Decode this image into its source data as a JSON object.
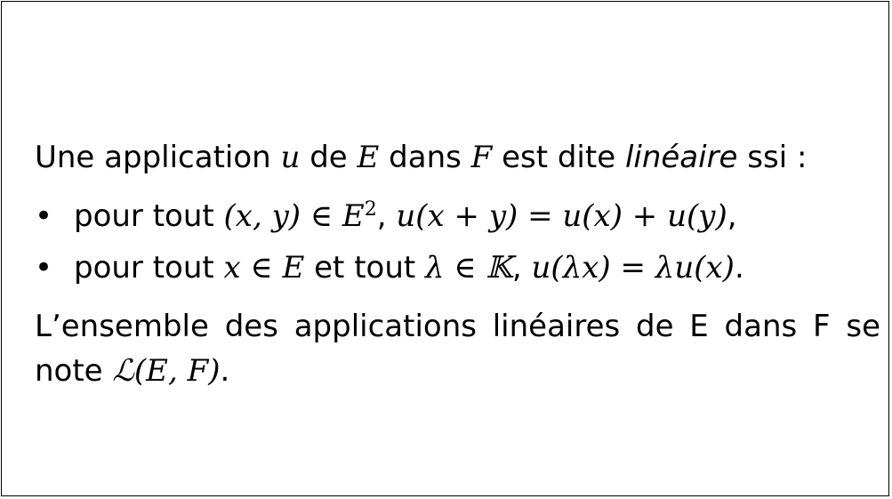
{
  "definition": {
    "intro": {
      "p1": "Une application ",
      "u": "u",
      "p2": " de ",
      "E": "E",
      "p3": " dans ",
      "F": "F",
      "p4": " est dite ",
      "emph": "linéaire",
      "p5": " ssi :"
    },
    "bullet_symbol": "•",
    "item1": {
      "p1": "pour tout ",
      "pair": "(x, y) ∈ E",
      "exp": "2",
      "p2": ", ",
      "formula": "u(x + y) = u(x) + u(y)",
      "p3": ","
    },
    "item2": {
      "p1": "pour tout ",
      "x_in_E": "x ∈ E",
      "p2": " et tout ",
      "lambda_in_K": "λ ∈ 𝕂",
      "p3": ", ",
      "formula": "u(λx) = λu(x)",
      "p4": "."
    },
    "set_def": {
      "line1": "L’ensemble des applications linéaires de E dans F se",
      "p1": "note ",
      "script_L": "ℒ",
      "args": "(E, F)",
      "p2": "."
    }
  }
}
